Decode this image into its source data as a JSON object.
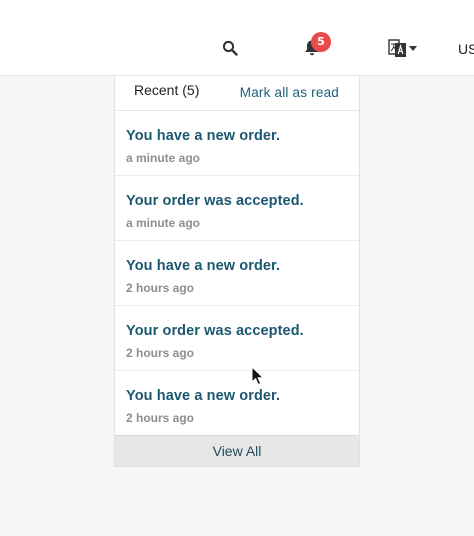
{
  "topbar": {
    "icons": {
      "search": "search-icon",
      "notifications": "bell-icon",
      "language": "translate-icon"
    },
    "notification_count": "5",
    "currency_label": "USD"
  },
  "dropdown": {
    "tab_recent_label": "Recent (5)",
    "mark_all_label": "Mark all as read",
    "items": [
      {
        "title": "You have a new order.",
        "time": "a minute ago"
      },
      {
        "title": "Your order was accepted.",
        "time": "a minute ago"
      },
      {
        "title": "You have a new order.",
        "time": "2 hours ago"
      },
      {
        "title": "Your order was accepted.",
        "time": "2 hours ago"
      },
      {
        "title": "You have a new order.",
        "time": "2 hours ago"
      }
    ],
    "view_all_label": "View All"
  },
  "colors": {
    "accent": "#1b5870",
    "badge": "#e94b4b",
    "muted": "#8e8e8e"
  }
}
